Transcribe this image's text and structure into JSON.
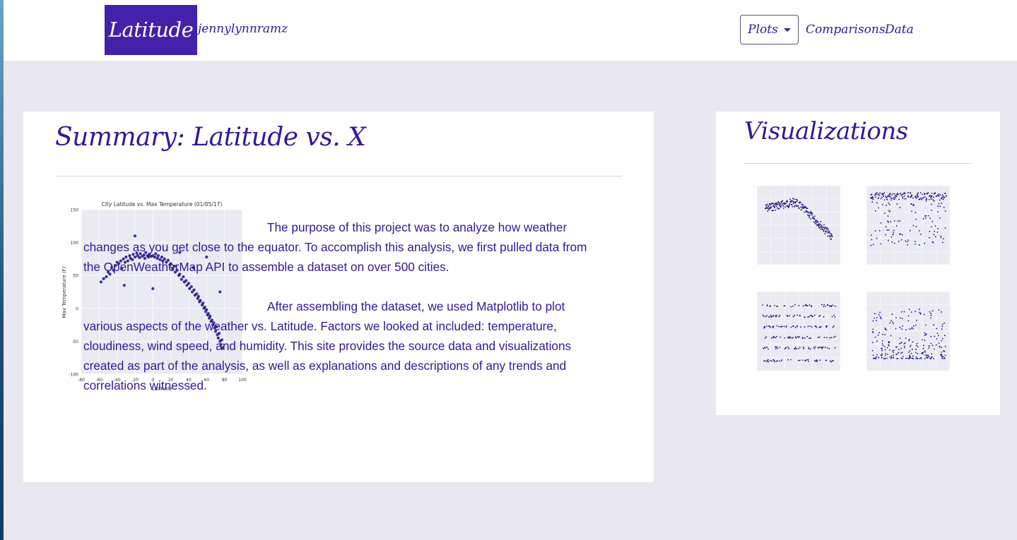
{
  "nav": {
    "brand": "Latitude",
    "user": "jennylynnramz",
    "plots_label": "Plots",
    "comparisons_label": "Comparisons",
    "data_label": "Data"
  },
  "summary": {
    "title": "Summary: Latitude vs. X",
    "paragraph1": "The purpose of this project was to analyze how weather changes as you get close to the equator. To accomplish this analysis, we first pulled data from the OpenWeatherMap API to assemble a dataset on over 500 cities.",
    "paragraph2": "After assembling the dataset, we used Matplotlib to plot various aspects of the weather vs. Latitude. Factors we looked at included: temperature, cloudiness, wind speed, and humidity. This site provides the source data and visualizations created as part of the analysis, as well as explanations and descriptions of any trends and correlations witnessed."
  },
  "visualizations": {
    "title": "Visualizations"
  },
  "colors": {
    "accent": "#4321a9",
    "text": "#2e1a9a",
    "background": "#e9e8f1",
    "panel": "#ffffff",
    "plot_bg": "#eaeaf2",
    "point": "#1f1080"
  },
  "chart_data": [
    {
      "type": "scatter",
      "title": "City Latitude vs. Max Temperature (01/05/17)",
      "xlabel": "Latitude",
      "ylabel": "Max Temperature (F)",
      "xlim": [
        -80,
        100
      ],
      "ylim": [
        -100,
        150
      ],
      "xticks": [
        "-80",
        "-60",
        "-40",
        "-20",
        "0",
        "20",
        "40",
        "60",
        "80",
        "100"
      ],
      "yticks": [
        "150",
        "100",
        "50",
        "0",
        "-50",
        "-100"
      ],
      "grid": true,
      "x": [
        -58,
        -55,
        -52,
        -50,
        -48,
        -46,
        -44,
        -42,
        -40,
        -38,
        -36,
        -35,
        -33,
        -31,
        -30,
        -28,
        -26,
        -25,
        -23,
        -22,
        -20,
        -18,
        -17,
        -15,
        -14,
        -12,
        -10,
        -9,
        -8,
        -6,
        -5,
        -4,
        -2,
        0,
        2,
        3,
        5,
        6,
        8,
        10,
        11,
        13,
        15,
        17,
        19,
        20,
        22,
        24,
        25,
        27,
        29,
        30,
        32,
        34,
        35,
        37,
        38,
        40,
        41,
        43,
        44,
        46,
        47,
        49,
        50,
        51,
        52,
        53,
        55,
        56,
        57,
        58,
        59,
        60,
        61,
        62,
        63,
        64,
        65,
        66,
        67,
        68,
        69,
        70,
        71,
        72,
        73,
        74,
        75,
        76,
        77,
        78,
        -32,
        -20,
        0,
        30,
        45,
        60,
        75
      ],
      "y": [
        40,
        45,
        48,
        55,
        52,
        62,
        58,
        65,
        70,
        68,
        72,
        60,
        75,
        70,
        78,
        72,
        80,
        76,
        74,
        82,
        78,
        84,
        80,
        77,
        83,
        79,
        81,
        76,
        85,
        80,
        78,
        82,
        79,
        80,
        78,
        83,
        76,
        80,
        74,
        78,
        72,
        75,
        70,
        73,
        66,
        68,
        60,
        64,
        55,
        58,
        50,
        52,
        44,
        48,
        40,
        42,
        35,
        38,
        30,
        33,
        25,
        28,
        20,
        22,
        15,
        18,
        10,
        12,
        5,
        8,
        0,
        2,
        -5,
        -2,
        -10,
        -8,
        -15,
        -12,
        -20,
        -18,
        -25,
        -22,
        -30,
        -35,
        -28,
        -40,
        -45,
        -38,
        -50,
        -55,
        -48,
        -60,
        35,
        110,
        30,
        85,
        62,
        78,
        25
      ]
    }
  ]
}
